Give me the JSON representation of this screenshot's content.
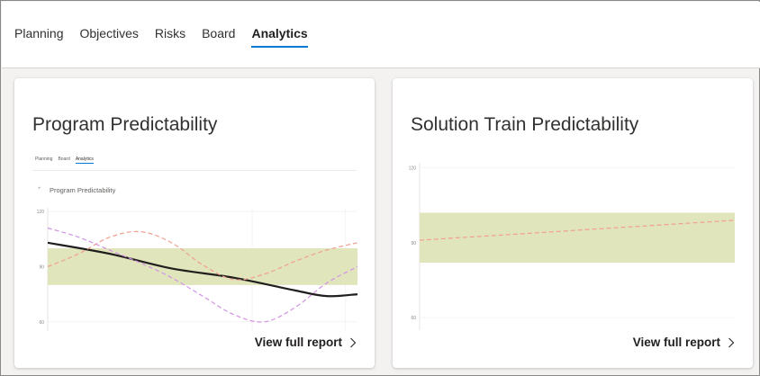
{
  "nav": {
    "tabs": [
      {
        "label": "Planning",
        "active": false
      },
      {
        "label": "Objectives",
        "active": false
      },
      {
        "label": "Risks",
        "active": false
      },
      {
        "label": "Board",
        "active": false
      },
      {
        "label": "Analytics",
        "active": true
      }
    ],
    "accent_color": "#0078d4"
  },
  "cards": [
    {
      "title": "Program Predictability",
      "link_label": "View full report",
      "link_icon": "chevron-right-icon",
      "preview": {
        "mini_tabs": [
          "Planning",
          "Board",
          "Analytics"
        ],
        "mini_active_tab": "Analytics",
        "chart_title": "Program Predictability"
      }
    },
    {
      "title": "Solution Train Predictability",
      "link_label": "View full report",
      "link_icon": "chevron-right-icon"
    }
  ],
  "chart_data": [
    {
      "type": "line",
      "y_ticks": [
        "120",
        "90",
        "60"
      ],
      "ylim": [
        55,
        122
      ],
      "xlim": [
        0,
        10
      ],
      "band": {
        "low": 80,
        "high": 100,
        "color": "#e1e5bc"
      },
      "series": [
        {
          "color": "#201f1e",
          "style": "solid",
          "points": [
            [
              0,
              103
            ],
            [
              2,
              97
            ],
            [
              4,
              89
            ],
            [
              6,
              84
            ],
            [
              8,
              77
            ],
            [
              9,
              74
            ],
            [
              10,
              75
            ]
          ]
        },
        {
          "color": "#f0a090",
          "style": "dashed",
          "points": [
            [
              0,
              90
            ],
            [
              1,
              97
            ],
            [
              2,
              106
            ],
            [
              3,
              109
            ],
            [
              4,
              103
            ],
            [
              5,
              91
            ],
            [
              6,
              83
            ],
            [
              7,
              86
            ],
            [
              8,
              93
            ],
            [
              9,
              99
            ],
            [
              10,
              103
            ]
          ]
        },
        {
          "color": "#d294e4",
          "style": "dashed",
          "points": [
            [
              0,
              111
            ],
            [
              1,
              106
            ],
            [
              2,
              99
            ],
            [
              3,
              92
            ],
            [
              4,
              84
            ],
            [
              5,
              74
            ],
            [
              6,
              64
            ],
            [
              7,
              60
            ],
            [
              8,
              68
            ],
            [
              9,
              81
            ],
            [
              10,
              90
            ]
          ]
        }
      ]
    },
    {
      "type": "line",
      "y_ticks": [
        "120",
        "90",
        "60"
      ],
      "ylim": [
        55,
        122
      ],
      "xlim": [
        0,
        10
      ],
      "band": {
        "low": 82,
        "high": 102,
        "color": "#e1e5bc"
      },
      "series": [
        {
          "color": "#f0a090",
          "style": "dashed",
          "points": [
            [
              0,
              91
            ],
            [
              10,
              99
            ]
          ]
        }
      ]
    }
  ]
}
